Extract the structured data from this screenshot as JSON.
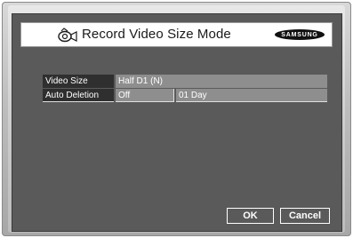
{
  "window": {
    "title": "Record Video Size Mode",
    "logo_text": "SAMSUNG"
  },
  "settings": [
    {
      "label": "Video Size",
      "value": "Half D1 (N)"
    },
    {
      "label": "Auto Deletion",
      "value": "Off",
      "value2": "01 Day"
    }
  ],
  "buttons": {
    "ok_label": "OK",
    "cancel_label": "Cancel"
  },
  "colors": {
    "screen_bg": "#5a5a5a",
    "label_bg": "#2f2f2f",
    "value_bg": "#8e8e8e"
  },
  "icons": {
    "title_icon": "record-camera-icon"
  }
}
